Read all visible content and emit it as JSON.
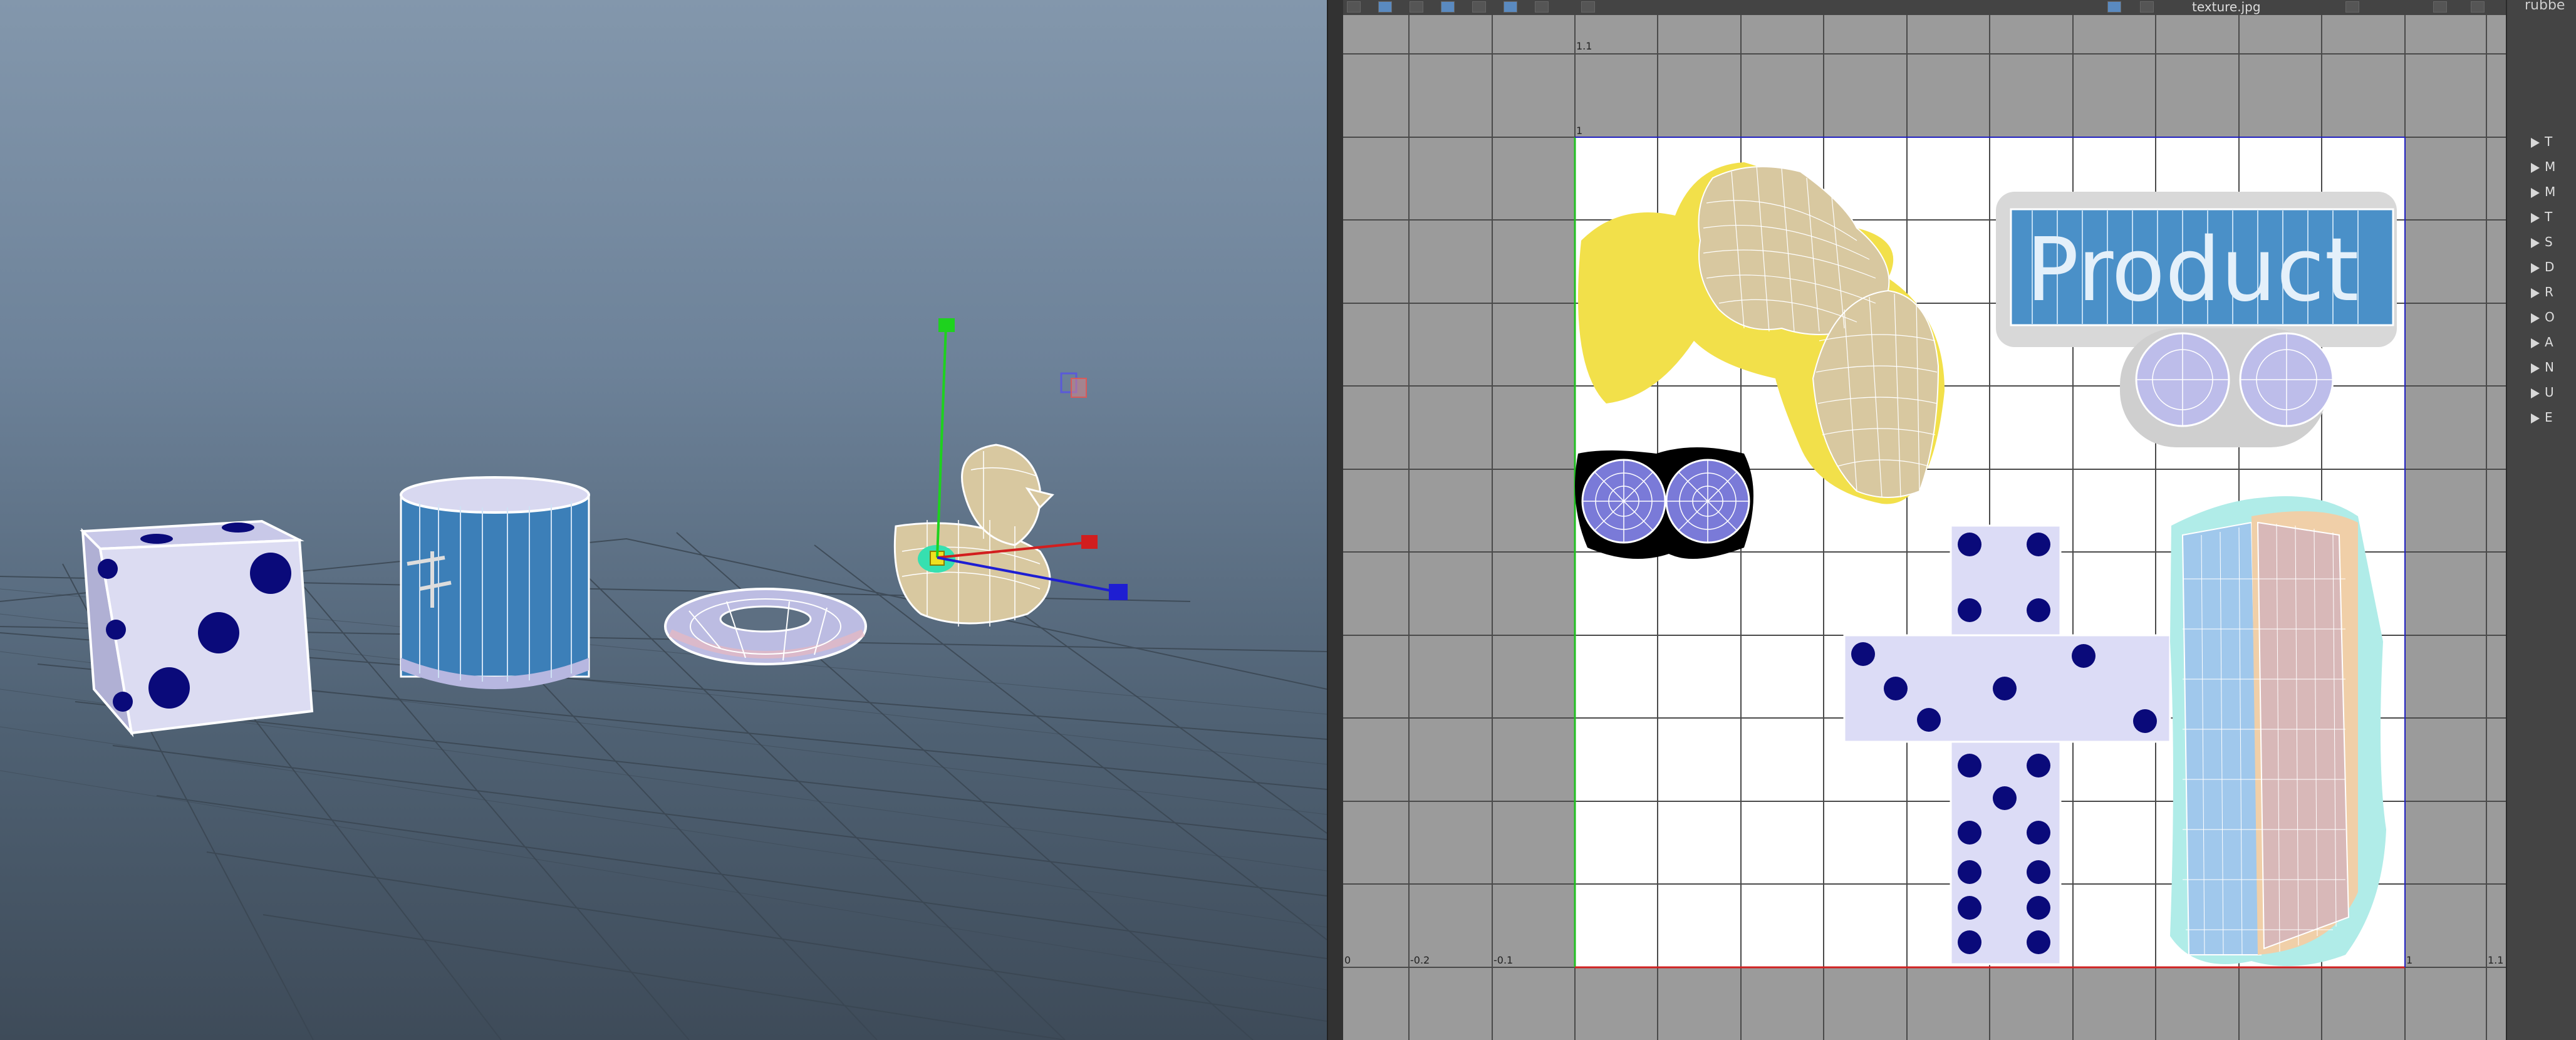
{
  "viewport": {
    "objects": [
      "dice",
      "cylinder-can",
      "torus-ring",
      "rubber-duck"
    ],
    "manipulator_axes": [
      "x-axis",
      "y-axis",
      "z-axis"
    ]
  },
  "uv_editor": {
    "texture_name": "texture.jpg",
    "texture_banner_text": "Product",
    "tick_labels": {
      "top_left": "1.1",
      "v_one": "1",
      "bottom_zero": "0",
      "bottom_neg02": "-0.2",
      "bottom_neg01": "-0.1",
      "bottom_one": "1",
      "bottom_11": "1.1"
    }
  },
  "attribute_panel": {
    "header": "rubbe",
    "sections": [
      "T",
      "M",
      "M",
      "T",
      "S",
      "D",
      "R",
      "O",
      "A",
      "N",
      "U",
      "E"
    ]
  },
  "colors": {
    "viewport_sky": "#8397ac",
    "uv_background": "#9a9a9a",
    "uv_grid": "#3a3a3a",
    "dice_blue": "#0a0a7a",
    "duck_yellow": "#f2e04a",
    "label_blue": "#4a90c8"
  }
}
